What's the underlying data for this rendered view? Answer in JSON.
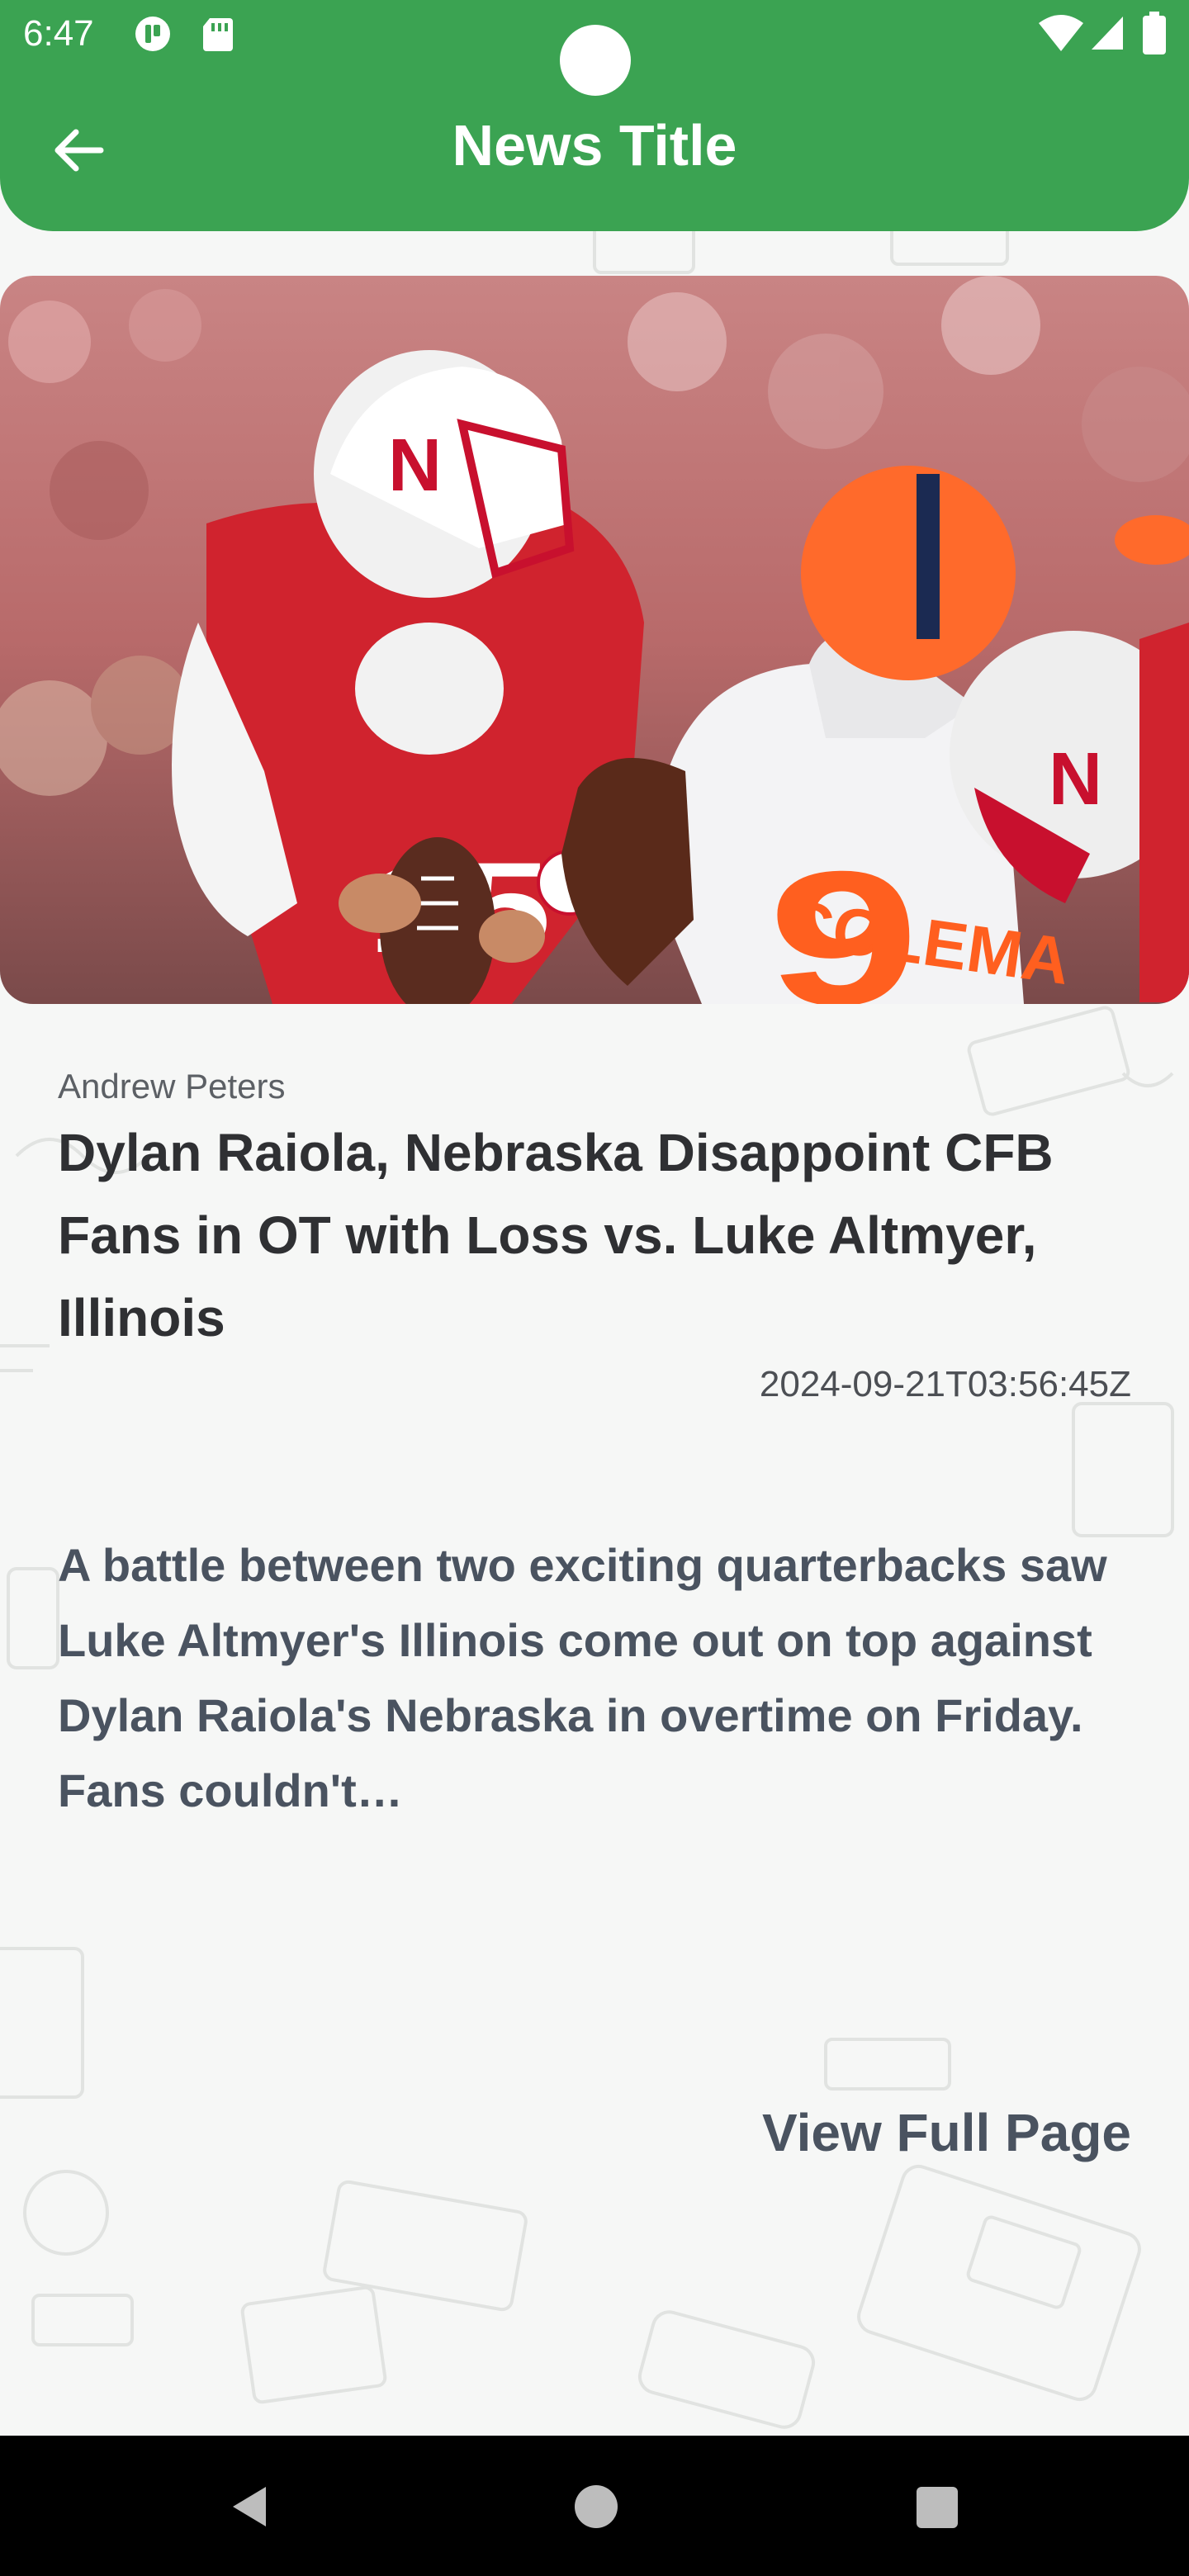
{
  "status_bar": {
    "time": "6:47",
    "icons": [
      "app-notification-icon",
      "sd-card-icon",
      "wifi-icon",
      "cell-signal-icon",
      "battery-icon"
    ]
  },
  "app_bar": {
    "title": "News Title",
    "back_icon": "arrow-back-icon",
    "color": "#3ba352"
  },
  "article": {
    "image": "football-players-photo",
    "author": "Andrew Peters",
    "headline": "Dylan Raiola, Nebraska Disappoint CFB Fans in OT with Loss vs. Luke Altmyer, Illinois",
    "published": "2024-09-21T03:56:45Z",
    "summary": "A battle between two exciting quarterbacks saw Luke Altmyer's Illinois come out on top against Dylan Raiola's Nebraska in overtime on Friday. Fans couldn't…",
    "view_full_label": "View Full Page"
  },
  "nav_bar": {
    "buttons": [
      "nav-back-icon",
      "nav-home-icon",
      "nav-recents-icon"
    ]
  }
}
